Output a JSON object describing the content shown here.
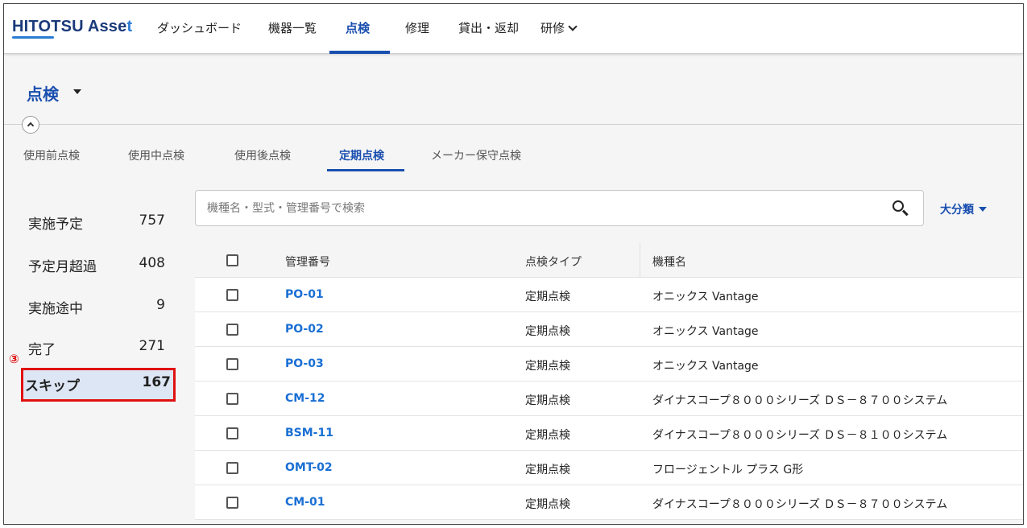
{
  "nav": {
    "logo_main": "HITOTSU Asse",
    "logo_tail": "t",
    "items": [
      "ダッシュボード",
      "機器一覧",
      "点検",
      "修理",
      "貸出・返却",
      "研修"
    ]
  },
  "page": {
    "title": "点検"
  },
  "subtabs": [
    "使用前点検",
    "使用中点検",
    "使用後点検",
    "定期点検",
    "メーカー保守点検"
  ],
  "status": [
    {
      "label": "実施予定",
      "count": "757"
    },
    {
      "label": "予定月超過",
      "count": "408"
    },
    {
      "label": "実施途中",
      "count": "9"
    },
    {
      "label": "完了",
      "count": "271"
    },
    {
      "label": "スキップ",
      "count": "167"
    }
  ],
  "annotation": "③",
  "search": {
    "placeholder": "機種名・型式・管理番号で検索"
  },
  "category": {
    "label": "大分類"
  },
  "table": {
    "headers": {
      "id": "管理番号",
      "type": "点検タイプ",
      "model": "機種名"
    },
    "rows": [
      {
        "id": "PO-01",
        "type": "定期点検",
        "model": "オニックス Vantage"
      },
      {
        "id": "PO-02",
        "type": "定期点検",
        "model": "オニックス Vantage"
      },
      {
        "id": "PO-03",
        "type": "定期点検",
        "model": "オニックス Vantage"
      },
      {
        "id": "CM-12",
        "type": "定期点検",
        "model": "ダイナスコープ８０００シリーズ ＤＳ－８７００システム"
      },
      {
        "id": "BSM-11",
        "type": "定期点検",
        "model": "ダイナスコープ８０００シリーズ ＤＳ－８１００システム"
      },
      {
        "id": "OMT-02",
        "type": "定期点検",
        "model": "フロージェントル プラス G形"
      },
      {
        "id": "CM-01",
        "type": "定期点検",
        "model": "ダイナスコープ８０００シリーズ ＤＳ－８７００システム"
      }
    ]
  },
  "colors": {
    "accent": "#1a4fb0",
    "link": "#1a6fd4",
    "highlight_border": "#e01010",
    "selected_bg": "#dde6f4"
  }
}
